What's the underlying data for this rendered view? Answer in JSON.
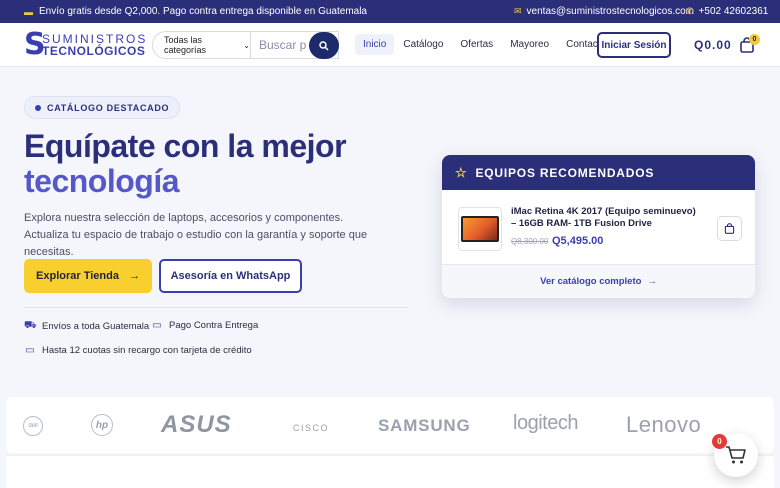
{
  "topbar": {
    "shipping": "Envío gratis desde Q2,000. Pago contra entrega disponible en Guatemala",
    "email": "ventas@suministrostecnologicos.com",
    "phone": "+502 42602361"
  },
  "logo": {
    "line1": "SUMINISTROS",
    "line2": "TECNOLÓGICOS"
  },
  "search": {
    "category": "Todas las categorías",
    "placeholder": "Buscar productos..."
  },
  "nav": [
    {
      "label": "Inicio",
      "active": true
    },
    {
      "label": "Catálogo"
    },
    {
      "label": "Ofertas"
    },
    {
      "label": "Mayoreo"
    },
    {
      "label": "Contacto"
    }
  ],
  "header": {
    "login": "Iniciar Sesión",
    "cart_total": "Q0.00",
    "cart_count": "0"
  },
  "hero": {
    "badge": "CATÁLOGO DESTACADO",
    "title1": "Equípate con la mejor",
    "title2": "tecnología",
    "description": "Explora nuestra selección de laptops, accesorios y componentes. Actualiza tu espacio de trabajo o estudio con la garantía y soporte que necesitas.",
    "explore": "Explorar Tienda",
    "whatsapp": "Asesoría en WhatsApp",
    "features": [
      "Envíos a toda Guatemala",
      "Pago Contra Entrega",
      "Hasta 12 cuotas sin recargo con tarjeta de crédito"
    ]
  },
  "recommended": {
    "title": "EQUIPOS RECOMENDADOS",
    "product": {
      "name": "iMac Retina 4K 2017 (Equipo seminuevo) – 16GB RAM- 1TB Fusion Drive",
      "old_price": "Q8,300.00",
      "price": "Q5,495.00"
    },
    "footer": "Ver catálogo completo"
  },
  "brands": [
    "dell",
    "hp",
    "ASUS",
    "CISCO",
    "SAMSUNG",
    "logitech",
    "Lenovo"
  ],
  "floating_cart": {
    "count": "0"
  }
}
